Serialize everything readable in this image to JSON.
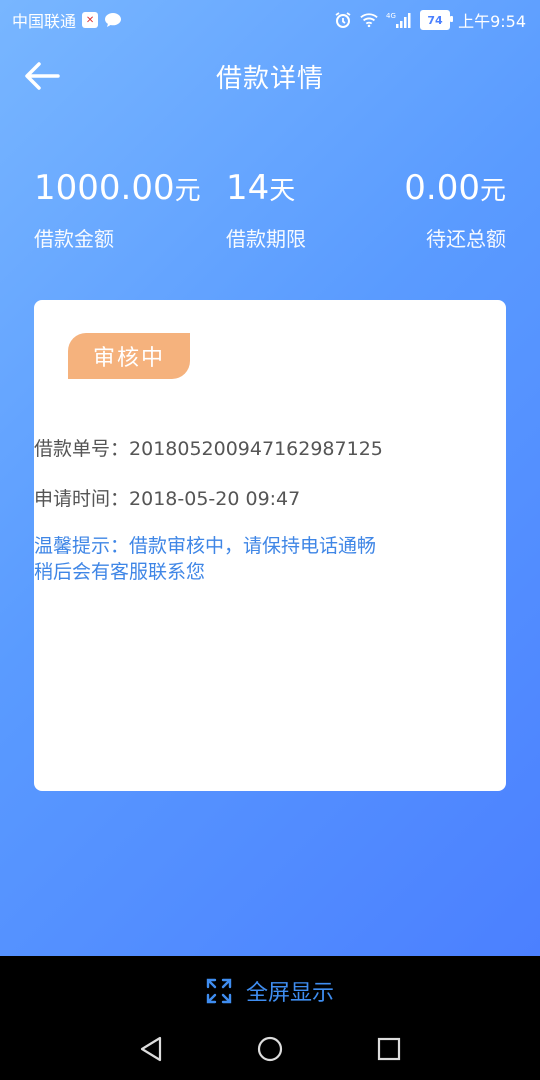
{
  "status_bar": {
    "carrier": "中国联通",
    "network": "4G",
    "battery": "74",
    "time": "上午9:54"
  },
  "header": {
    "title": "借款详情",
    "back_icon": "arrow-left-icon"
  },
  "summary": {
    "amount": {
      "value": "1000.00",
      "unit": "元",
      "label": "借款金额"
    },
    "term": {
      "value": "14",
      "unit": "天",
      "label": "借款期限"
    },
    "total_due": {
      "value": "0.00",
      "unit": "元",
      "label": "待还总额"
    }
  },
  "card": {
    "status_badge": "审核中",
    "order_no_label": "借款单号：",
    "order_no": "20180520094716298712​5",
    "apply_time_label": "申请时间：",
    "apply_time": "2018-05-20 09:47",
    "tip_line1": "温馨提示：借款审核中，请保持电话通畅",
    "tip_line2": "稍后会有客服联系您"
  },
  "fullscreen": {
    "label": "全屏显示"
  },
  "colors": {
    "gradient_start": "#78b6ff",
    "gradient_end": "#4b80ff",
    "badge": "#f5b27d",
    "tip": "#3f86e6",
    "fullscreen": "#3f8df0"
  }
}
